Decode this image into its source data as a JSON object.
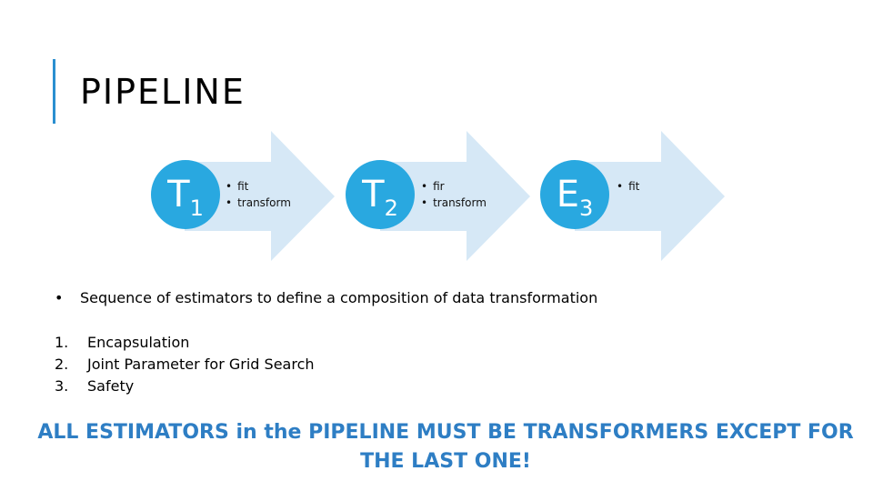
{
  "title": "PIPELINE",
  "stages": [
    {
      "letter": "T",
      "subscript": "1",
      "methods": [
        "fit",
        "transform"
      ]
    },
    {
      "letter": "T",
      "subscript": "2",
      "methods": [
        "fir",
        "transform"
      ]
    },
    {
      "letter": "E",
      "subscript": "3",
      "methods": [
        "fit"
      ]
    }
  ],
  "bullet": "Sequence of estimators to define a composition of data transformation",
  "numbered": [
    {
      "num": "1.",
      "text": "Encapsulation"
    },
    {
      "num": "2.",
      "text": "Joint Parameter for Grid Search"
    },
    {
      "num": "3.",
      "text": "Safety"
    }
  ],
  "conclusion": "ALL ESTIMATORS in the PIPELINE MUST BE TRANSFORMERS EXCEPT FOR THE LAST ONE!",
  "colors": {
    "accent": "#2b8fd0",
    "circle": "#29a8e0",
    "arrow": "#d6e8f6",
    "conclusion": "#2e7ec4"
  }
}
